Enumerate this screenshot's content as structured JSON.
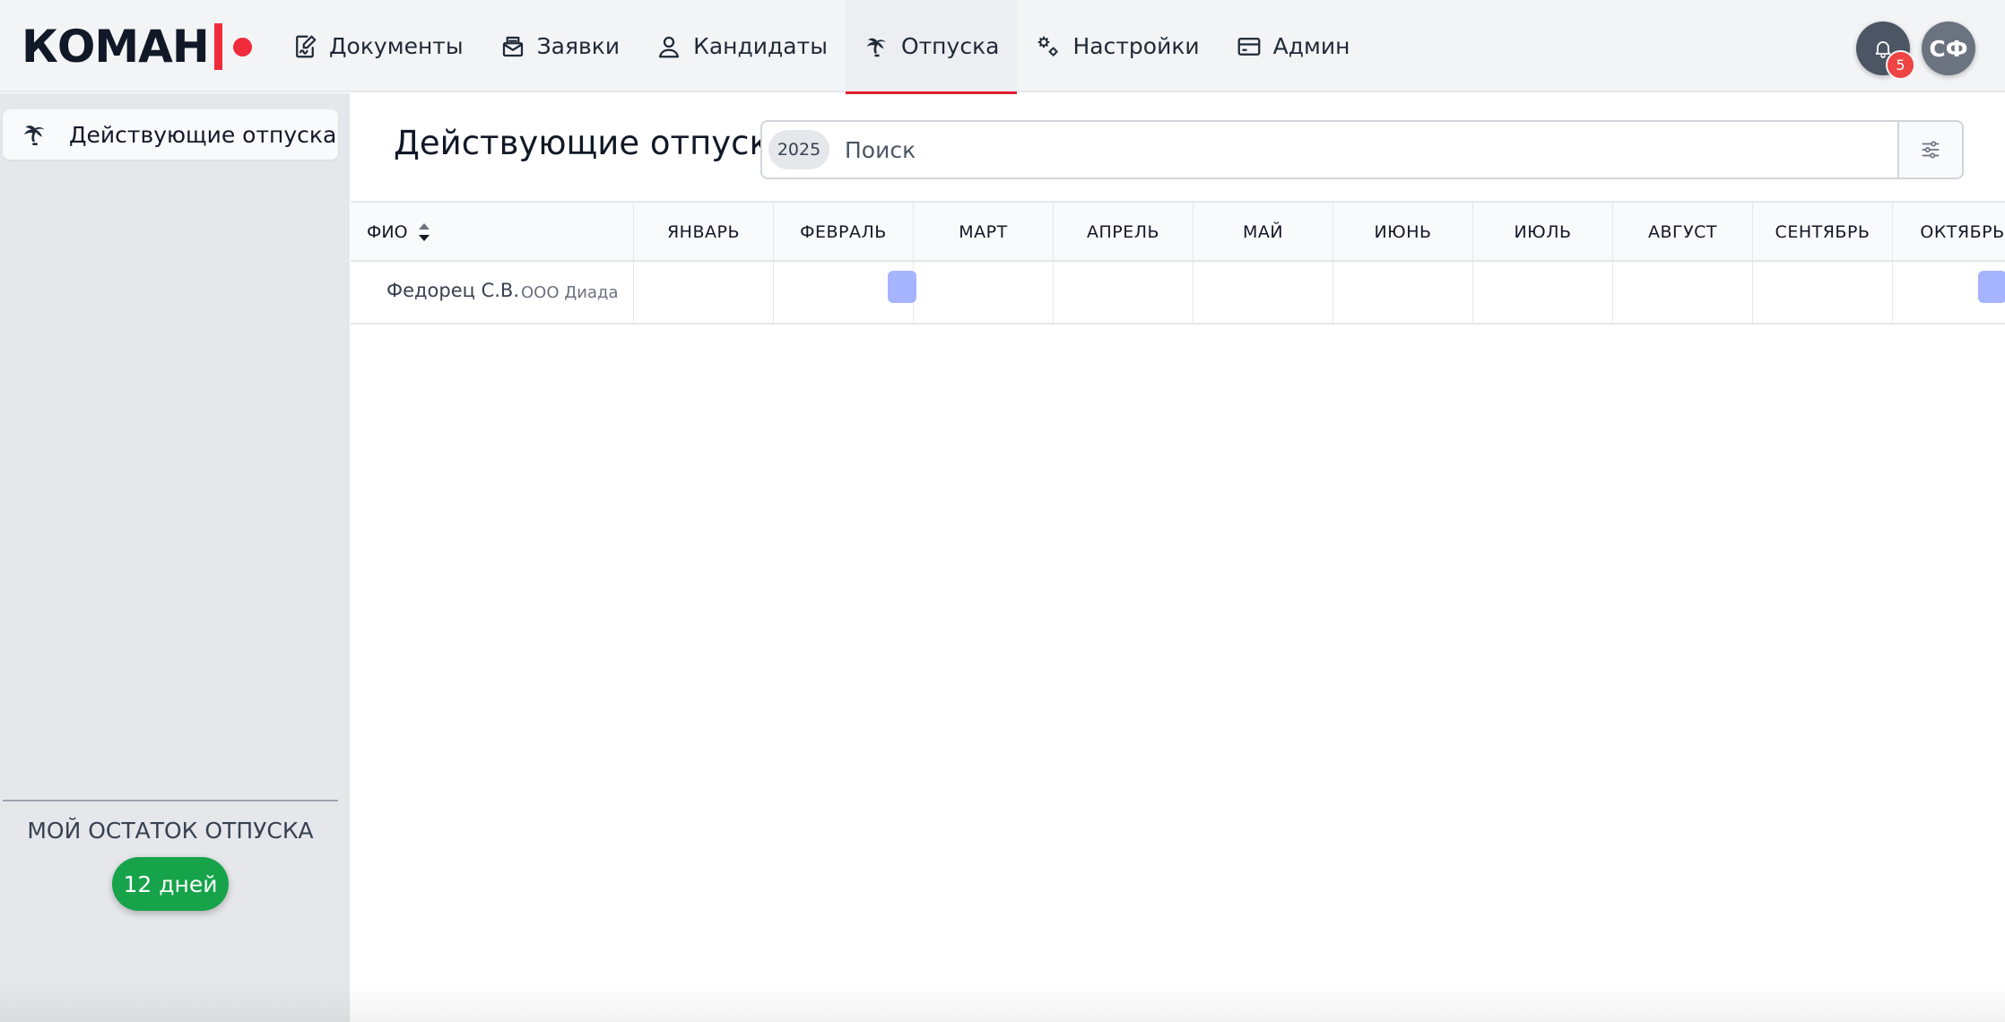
{
  "app": {
    "logo_text": "КОМАН"
  },
  "nav": {
    "items": [
      {
        "label": "Документы",
        "icon": "document-edit-icon"
      },
      {
        "label": "Заявки",
        "icon": "inbox-icon"
      },
      {
        "label": "Кандидаты",
        "icon": "user-icon"
      },
      {
        "label": "Отпуска",
        "icon": "palm-tree-icon",
        "active": true
      },
      {
        "label": "Настройки",
        "icon": "gears-icon"
      },
      {
        "label": "Админ",
        "icon": "card-icon"
      }
    ]
  },
  "header": {
    "notifications_count": "5",
    "avatar_initials": "СФ"
  },
  "sidebar": {
    "items": [
      {
        "label": "Действующие отпуска",
        "icon": "palm-tree-icon"
      }
    ],
    "remaining_label": "МОЙ ОСТАТОК ОТПУСКА",
    "remaining_value": "12 дней"
  },
  "main": {
    "title": "Действующие отпуска",
    "search": {
      "year": "2025",
      "placeholder": "Поиск",
      "value": ""
    },
    "table": {
      "name_header": "ФИО",
      "months": [
        "ЯНВАРЬ",
        "ФЕВРАЛЬ",
        "МАРТ",
        "АПРЕЛЬ",
        "МАЙ",
        "ИЮНЬ",
        "ИЮЛЬ",
        "АВГУСТ",
        "СЕНТЯБРЬ",
        "ОКТЯБРЬ"
      ],
      "rows": [
        {
          "name": "Федорец С.В.",
          "org": "ООО Диада"
        }
      ]
    }
  },
  "colors": {
    "accent": "#e11d2e",
    "vacation_mark": "#a5b4fc",
    "remaining_pill": "#16a34a"
  }
}
